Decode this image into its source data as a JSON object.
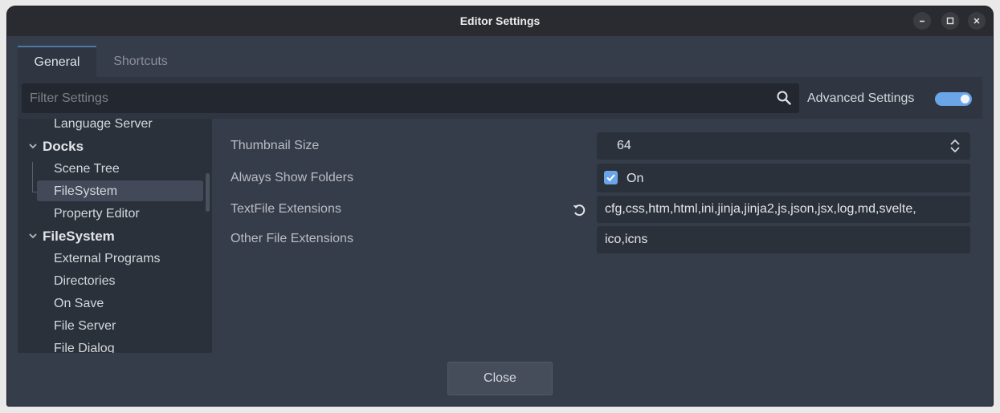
{
  "window": {
    "title": "Editor Settings"
  },
  "tabs": [
    {
      "label": "General"
    },
    {
      "label": "Shortcuts"
    }
  ],
  "filter": {
    "placeholder": "Filter Settings"
  },
  "advanced": {
    "label": "Advanced Settings",
    "enabled": true
  },
  "tree": {
    "items": [
      {
        "label": "Language Server"
      },
      {
        "label": "Docks"
      },
      {
        "label": "Scene Tree"
      },
      {
        "label": "FileSystem"
      },
      {
        "label": "Property Editor"
      },
      {
        "label": "FileSystem"
      },
      {
        "label": "External Programs"
      },
      {
        "label": "Directories"
      },
      {
        "label": "On Save"
      },
      {
        "label": "File Server"
      },
      {
        "label": "File Dialog"
      }
    ]
  },
  "properties": [
    {
      "label": "Thumbnail Size",
      "value": "64"
    },
    {
      "label": "Always Show Folders",
      "value": "On"
    },
    {
      "label": "TextFile Extensions",
      "value": "cfg,css,htm,html,ini,jinja,jinja2,js,json,jsx,log,md,svelte,"
    },
    {
      "label": "Other File Extensions",
      "value": "ico,icns"
    }
  ],
  "footer": {
    "close_label": "Close"
  },
  "colors": {
    "accent": "#6aa6e7",
    "background": "#363d4a",
    "titlebar": "#2a2b30"
  }
}
